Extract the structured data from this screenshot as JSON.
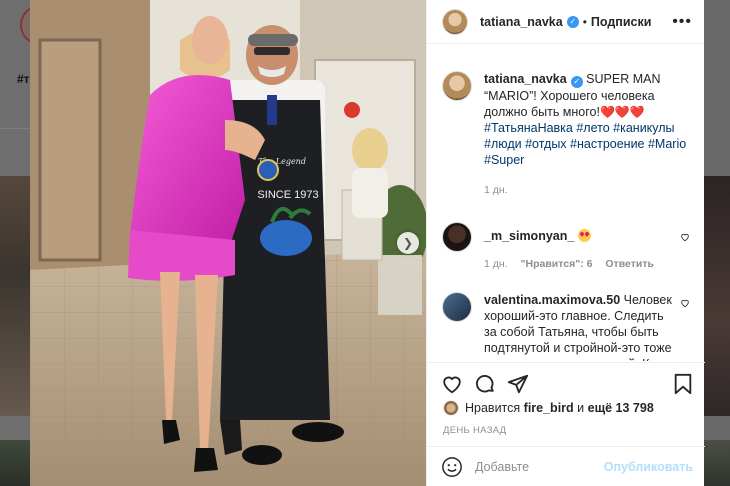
{
  "background": {
    "left_hashtag": "#т"
  },
  "post": {
    "header": {
      "username": "tatiana_navka",
      "separator": "•",
      "follow_label": "Подписки",
      "more_label": "•••"
    },
    "caption": {
      "username": "tatiana_navka",
      "text": "SUPER MAN “MARIO”! Хорошего человека должно быть много!",
      "hearts": "❤️❤️❤️",
      "hashtags": "#ТатьянаНавка #лето #каникулы #люди #отдых #настроение #Mario #Super",
      "age": "1 дн."
    },
    "comments": [
      {
        "username": "_m_simonyan_",
        "text": "",
        "age": "1 дн.",
        "likes_label": "\"Нравится\": 6",
        "reply_label": "Ответить"
      },
      {
        "username": "valentina.maximova.50",
        "text": "Человек хороший-это главное. Следить за собой Татьяна, чтобы быть подтянутой и стройной-это тоже труд, имея двоих дочерей. Как сказал О.Хайям: Дети нас не учат... Дети нас..."
      }
    ],
    "likes": {
      "prefix": "Нравится",
      "liked_by": "fire_bird",
      "connector": "и",
      "others": "ещё 13 798"
    },
    "date_label": "ДЕНЬ НАЗАД",
    "add_comment": {
      "placeholder": "Добавьте",
      "publish_label": "Опубликовать"
    },
    "photo": {
      "apron_text": "SINCE 1973",
      "apron_script": "The Legend"
    }
  },
  "colors": {
    "verified": "#3897f0",
    "link": "#00376b",
    "muted": "#8e8e8e",
    "publish_disabled": "#b2dffc",
    "heart": "#ed4956"
  }
}
